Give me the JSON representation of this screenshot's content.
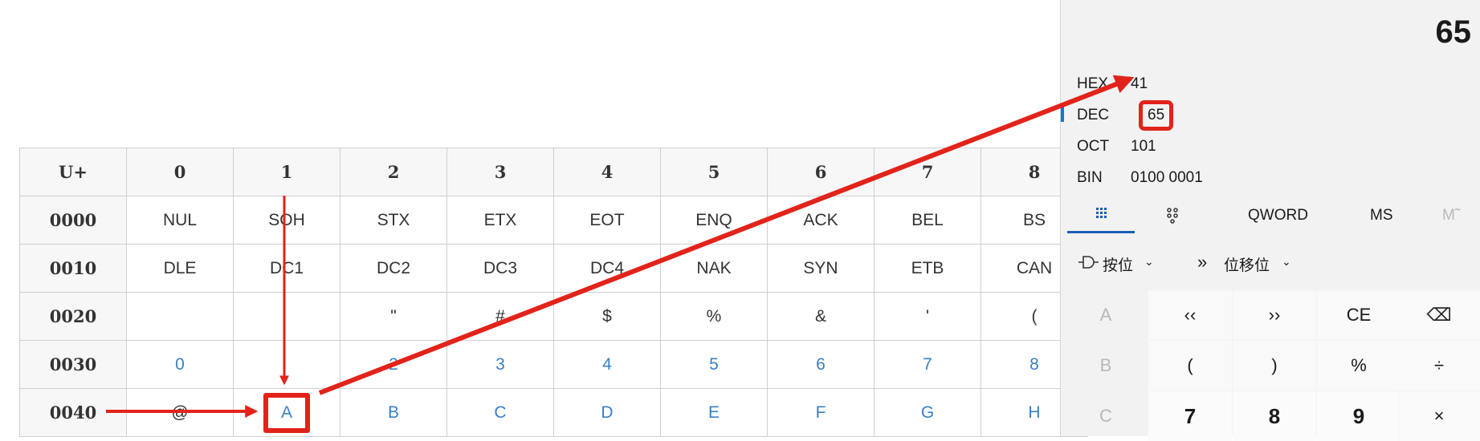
{
  "table": {
    "header": [
      "U+",
      "0",
      "1",
      "2",
      "3",
      "4",
      "5",
      "6",
      "7",
      "8"
    ],
    "rows": [
      {
        "code": "0000",
        "cells": [
          "NUL",
          "SOH",
          "STX",
          "ETX",
          "EOT",
          "ENQ",
          "ACK",
          "BEL",
          "BS"
        ]
      },
      {
        "code": "0010",
        "cells": [
          "DLE",
          "DC1",
          "DC2",
          "DC3",
          "DC4",
          "NAK",
          "SYN",
          "ETB",
          "CAN"
        ]
      },
      {
        "code": "0020",
        "cells": [
          "",
          "",
          "\"",
          "#",
          "$",
          "%",
          "&",
          "'",
          "("
        ]
      },
      {
        "code": "0030",
        "cells": [
          "0",
          "",
          "2",
          "3",
          "4",
          "5",
          "6",
          "7",
          "8"
        ]
      },
      {
        "code": "0040",
        "cells": [
          "@",
          "A",
          "B",
          "C",
          "D",
          "E",
          "F",
          "G",
          "H"
        ]
      }
    ]
  },
  "calculator": {
    "display": "65",
    "radix": [
      {
        "label": "HEX",
        "value": "41"
      },
      {
        "label": "DEC",
        "value": "65"
      },
      {
        "label": "OCT",
        "value": "101"
      },
      {
        "label": "BIN",
        "value": "0100 0001"
      }
    ],
    "modes": {
      "keypad_icon": "keypad-icon",
      "bitflip_icon": "bit-toggle-icon",
      "word_size": "QWORD",
      "memory_store": "MS",
      "memory_recall": "M˜"
    },
    "ops": {
      "bitwise": "按位",
      "bitshift": "位移位"
    },
    "keys": [
      [
        "A",
        "‹‹",
        "››",
        "CE",
        "⌫"
      ],
      [
        "B",
        "(",
        ")",
        "%",
        "÷"
      ],
      [
        "C",
        "7",
        "8",
        "9",
        "×"
      ]
    ]
  },
  "colors": {
    "link": "#3a80c4",
    "annotation": "#e2231a",
    "accent": "#1a5fb4"
  }
}
